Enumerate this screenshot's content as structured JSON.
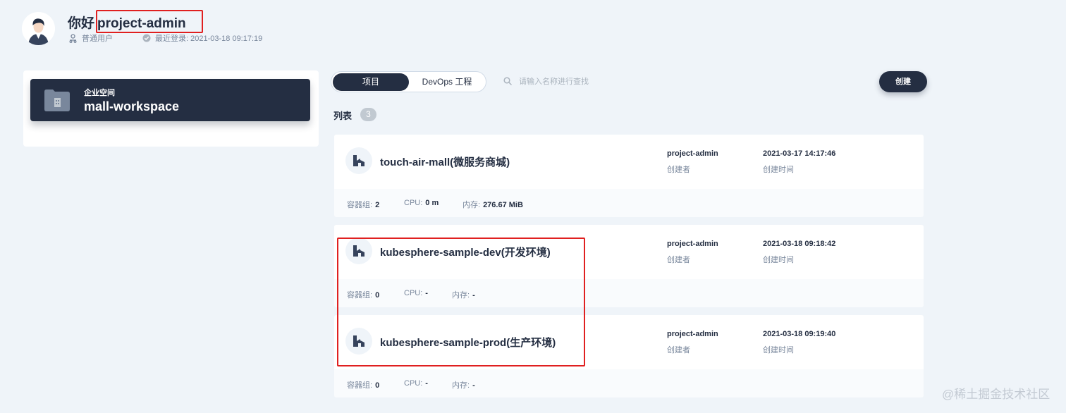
{
  "user": {
    "greeting_prefix": "你好",
    "name": "project-admin",
    "role": "普通用户",
    "last_login_label": "最近登录:",
    "last_login_time": "2021-03-18 09:17:19"
  },
  "workspace": {
    "label": "企业空间",
    "name": "mall-workspace"
  },
  "toolbar": {
    "tabs": [
      {
        "label": "项目",
        "active": true
      },
      {
        "label": "DevOps 工程",
        "active": false
      }
    ],
    "search_placeholder": "请输入名称进行查找",
    "create_label": "创建"
  },
  "list": {
    "title": "列表",
    "count": "3",
    "columns": {
      "creator": "创建者",
      "created_time": "创建时间"
    },
    "stat_labels": {
      "pods": "容器组:",
      "cpu": "CPU:",
      "memory": "内存:"
    },
    "projects": [
      {
        "name": "touch-air-mall(微服务商城)",
        "creator": "project-admin",
        "created_time": "2021-03-17 14:17:46",
        "pods": "2",
        "cpu": "0 m",
        "memory": "276.67 MiB"
      },
      {
        "name": "kubesphere-sample-dev(开发环境)",
        "creator": "project-admin",
        "created_time": "2021-03-18 09:18:42",
        "pods": "0",
        "cpu": "-",
        "memory": "-"
      },
      {
        "name": "kubesphere-sample-prod(生产环境)",
        "creator": "project-admin",
        "created_time": "2021-03-18 09:19:40",
        "pods": "0",
        "cpu": "-",
        "memory": "-"
      }
    ]
  },
  "watermark": "@稀土掘金技术社区",
  "colors": {
    "background": "#eff4f9",
    "dark": "#242e42",
    "muted": "#79879c",
    "highlight": "#e02020"
  }
}
